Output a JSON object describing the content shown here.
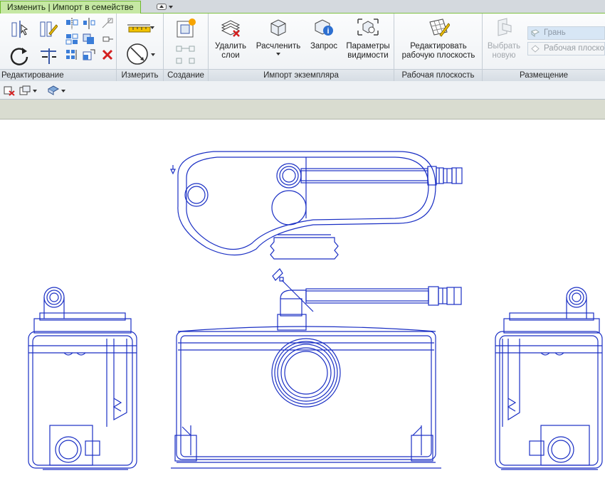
{
  "tabs": {
    "context_tab": "Изменить | Импорт в семействе"
  },
  "panels": {
    "modify": {
      "title": "Редактирование"
    },
    "measure": {
      "title": "Измерить"
    },
    "create": {
      "title": "Создание"
    },
    "import_instance": {
      "title": "Импорт экземпляра",
      "delete_layers": {
        "line1": "Удалить",
        "line2": "слои"
      },
      "explode": {
        "label": "Расчленить"
      },
      "query": {
        "label": "Запрос"
      },
      "visibility": {
        "line1": "Параметры",
        "line2": "видимости"
      }
    },
    "work_plane": {
      "title": "Рабочая плоскость",
      "edit_work_plane": {
        "line1": "Редактировать",
        "line2": "рабочую плоскость"
      }
    },
    "placement": {
      "title": "Размещение",
      "pick_new": {
        "line1": "Выбрать",
        "line2": "новую"
      },
      "face_option": "Грань",
      "work_plane_option": "Рабочая плоскость"
    }
  },
  "colors": {
    "context_tab_bg": "#c6e8a4",
    "drawing_line": "#1a2fc4",
    "options_bar_bg": "#d9dcd0"
  },
  "icons": [
    "align-icon",
    "offset-icon",
    "mirror-axis-icon",
    "mirror-draw-icon",
    "rotate-icon",
    "trim-extend-icon",
    "move-icon",
    "copy-icon",
    "split-icon",
    "array-icon",
    "scale-icon",
    "pin-icon",
    "delete-icon",
    "aligned-dimension-icon",
    "measure-icon",
    "create-similar-icon",
    "create-group-icon",
    "delete-layers-icon",
    "explode-icon",
    "query-icon",
    "visibility-settings-icon",
    "edit-work-plane-icon",
    "pick-new-icon",
    "hide-in-view-icon",
    "override-graphics-icon",
    "select-filter-icon"
  ]
}
